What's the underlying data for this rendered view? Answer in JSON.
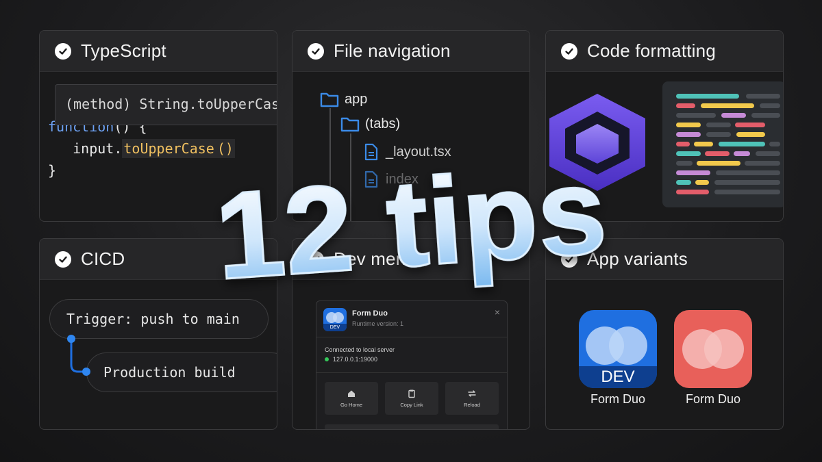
{
  "cards": {
    "typescript": {
      "title": "TypeScript",
      "tooltip": "(method) String.toUpperCase",
      "code_line1_kw": "function",
      "code_line1_rest": "() {",
      "code_line2_obj": "input.",
      "code_line2_method": "toUpperCase",
      "code_line2_call": "()",
      "code_line3": "}"
    },
    "file_navigation": {
      "title": "File navigation",
      "items": [
        "app",
        "(tabs)",
        "_layout.tsx",
        "index"
      ]
    },
    "code_formatting": {
      "title": "Code formatting"
    },
    "cicd": {
      "title": "CICD",
      "step1": "Trigger: push to main",
      "step2": "Production build"
    },
    "dev_menu": {
      "title": "Dev menu",
      "app_name": "Form Duo",
      "runtime": "Runtime version: 1",
      "badge": "DEV",
      "connected": "Connected to local server",
      "address": "127.0.0.1:19000",
      "buttons": [
        "Go Home",
        "Copy Link",
        "Reload"
      ]
    },
    "app_variants": {
      "title": "App variants",
      "dev_badge": "DEV",
      "label_dev": "Form Duo",
      "label_prod": "Form Duo"
    }
  },
  "headline": "12 tips",
  "colors": {
    "folder_blue": "#3b8be8",
    "status_green": "#34c759",
    "dev_blue": "#1f6fe0",
    "prod_red": "#e8605a",
    "headline_top": "#ffffff",
    "headline_bottom": "#7ab9f0"
  }
}
